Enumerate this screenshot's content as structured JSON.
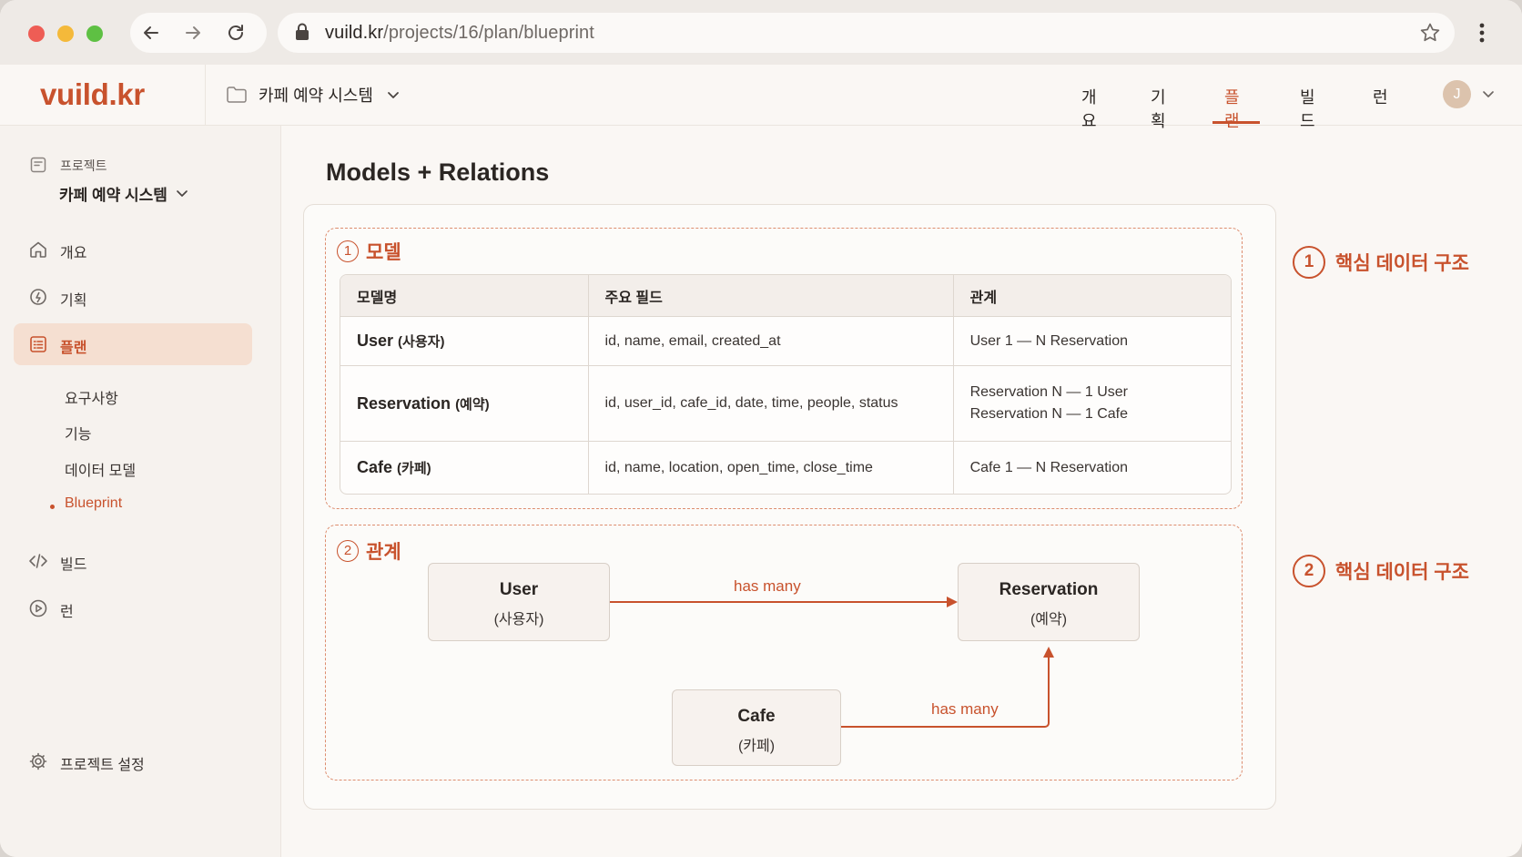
{
  "browser": {
    "url_host": "vuild.kr",
    "url_path": "/projects/16/plan/blueprint"
  },
  "app": {
    "logo": "vuild.kr",
    "project_selector": "카페 예약 시스템",
    "top_nav": [
      {
        "label": "개요"
      },
      {
        "label": "기획"
      },
      {
        "label": "플랜",
        "active": true
      },
      {
        "label": "빌드"
      },
      {
        "label": "런"
      }
    ],
    "avatar_initial": "J"
  },
  "sidebar": {
    "project_label": "프로젝트",
    "project_name": "카페 예약 시스템",
    "items": [
      {
        "label": "개요",
        "icon": "home-icon"
      },
      {
        "label": "기획",
        "icon": "lightbulb-icon"
      },
      {
        "label": "플랜",
        "icon": "plan-list-icon",
        "active": true
      },
      {
        "label": "빌드",
        "icon": "code-icon"
      },
      {
        "label": "런",
        "icon": "play-icon"
      }
    ],
    "sub_items": [
      {
        "label": "요구사항"
      },
      {
        "label": "기능"
      },
      {
        "label": "데이터 모델"
      },
      {
        "label": "Blueprint",
        "active": true
      }
    ],
    "settings_label": "프로젝트 설정"
  },
  "main": {
    "title": "Models + Relations",
    "section1": {
      "number": "1",
      "title": "모델"
    },
    "section2": {
      "number": "2",
      "title": "관계"
    },
    "table": {
      "headers": [
        "모델명",
        "주요 필드",
        "관계"
      ],
      "rows": [
        {
          "name": "User",
          "name_ko": "(사용자)",
          "fields": "id, name, email, created_at",
          "relations": [
            "User 1 — N Reservation"
          ]
        },
        {
          "name": "Reservation",
          "name_ko": "(예약)",
          "fields": "id, user_id, cafe_id, date, time, people, status",
          "relations": [
            "Reservation N — 1 User",
            "Reservation N — 1 Cafe"
          ]
        },
        {
          "name": "Cafe",
          "name_ko": "(카페)",
          "fields": "id, name, location, open_time, close_time",
          "relations": [
            "Cafe 1 — N Reservation"
          ]
        }
      ]
    },
    "diagram": {
      "nodes": {
        "user": {
          "name": "User",
          "name_ko": "(사용자)"
        },
        "reservation": {
          "name": "Reservation",
          "name_ko": "(예약)"
        },
        "cafe": {
          "name": "Cafe",
          "name_ko": "(카페)"
        }
      },
      "edges": [
        {
          "from": "user",
          "to": "reservation",
          "label": "has many"
        },
        {
          "from": "cafe",
          "to": "reservation",
          "label": "has many"
        }
      ]
    }
  },
  "annotations": [
    {
      "number": "1",
      "text": "핵심 데이터 구조"
    },
    {
      "number": "2",
      "text": "핵심 데이터 구조"
    }
  ],
  "colors": {
    "accent": "#c8522d",
    "active_bg": "#f5dfd1",
    "background": "#faf7f4"
  }
}
